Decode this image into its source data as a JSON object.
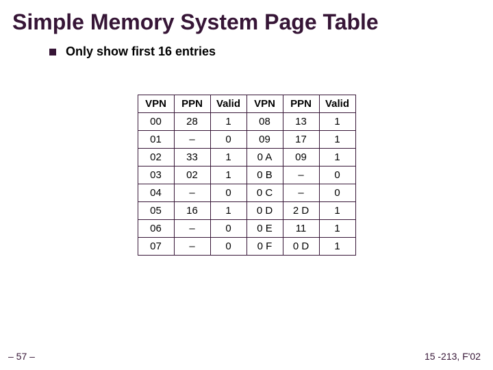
{
  "title": "Simple Memory System Page Table",
  "subtitle": "Only show first 16 entries",
  "headers": [
    "VPN",
    "PPN",
    "Valid",
    "VPN",
    "PPN",
    "Valid"
  ],
  "rows": [
    [
      "00",
      "28",
      "1",
      "08",
      "13",
      "1"
    ],
    [
      "01",
      "–",
      "0",
      "09",
      "17",
      "1"
    ],
    [
      "02",
      "33",
      "1",
      "0 A",
      "09",
      "1"
    ],
    [
      "03",
      "02",
      "1",
      "0 B",
      "–",
      "0"
    ],
    [
      "04",
      "–",
      "0",
      "0 C",
      "–",
      "0"
    ],
    [
      "05",
      "16",
      "1",
      "0 D",
      "2 D",
      "1"
    ],
    [
      "06",
      "–",
      "0",
      "0 E",
      "11",
      "1"
    ],
    [
      "07",
      "–",
      "0",
      "0 F",
      "0 D",
      "1"
    ]
  ],
  "footer": {
    "left": "– 57 –",
    "right": "15 -213, F'02"
  }
}
